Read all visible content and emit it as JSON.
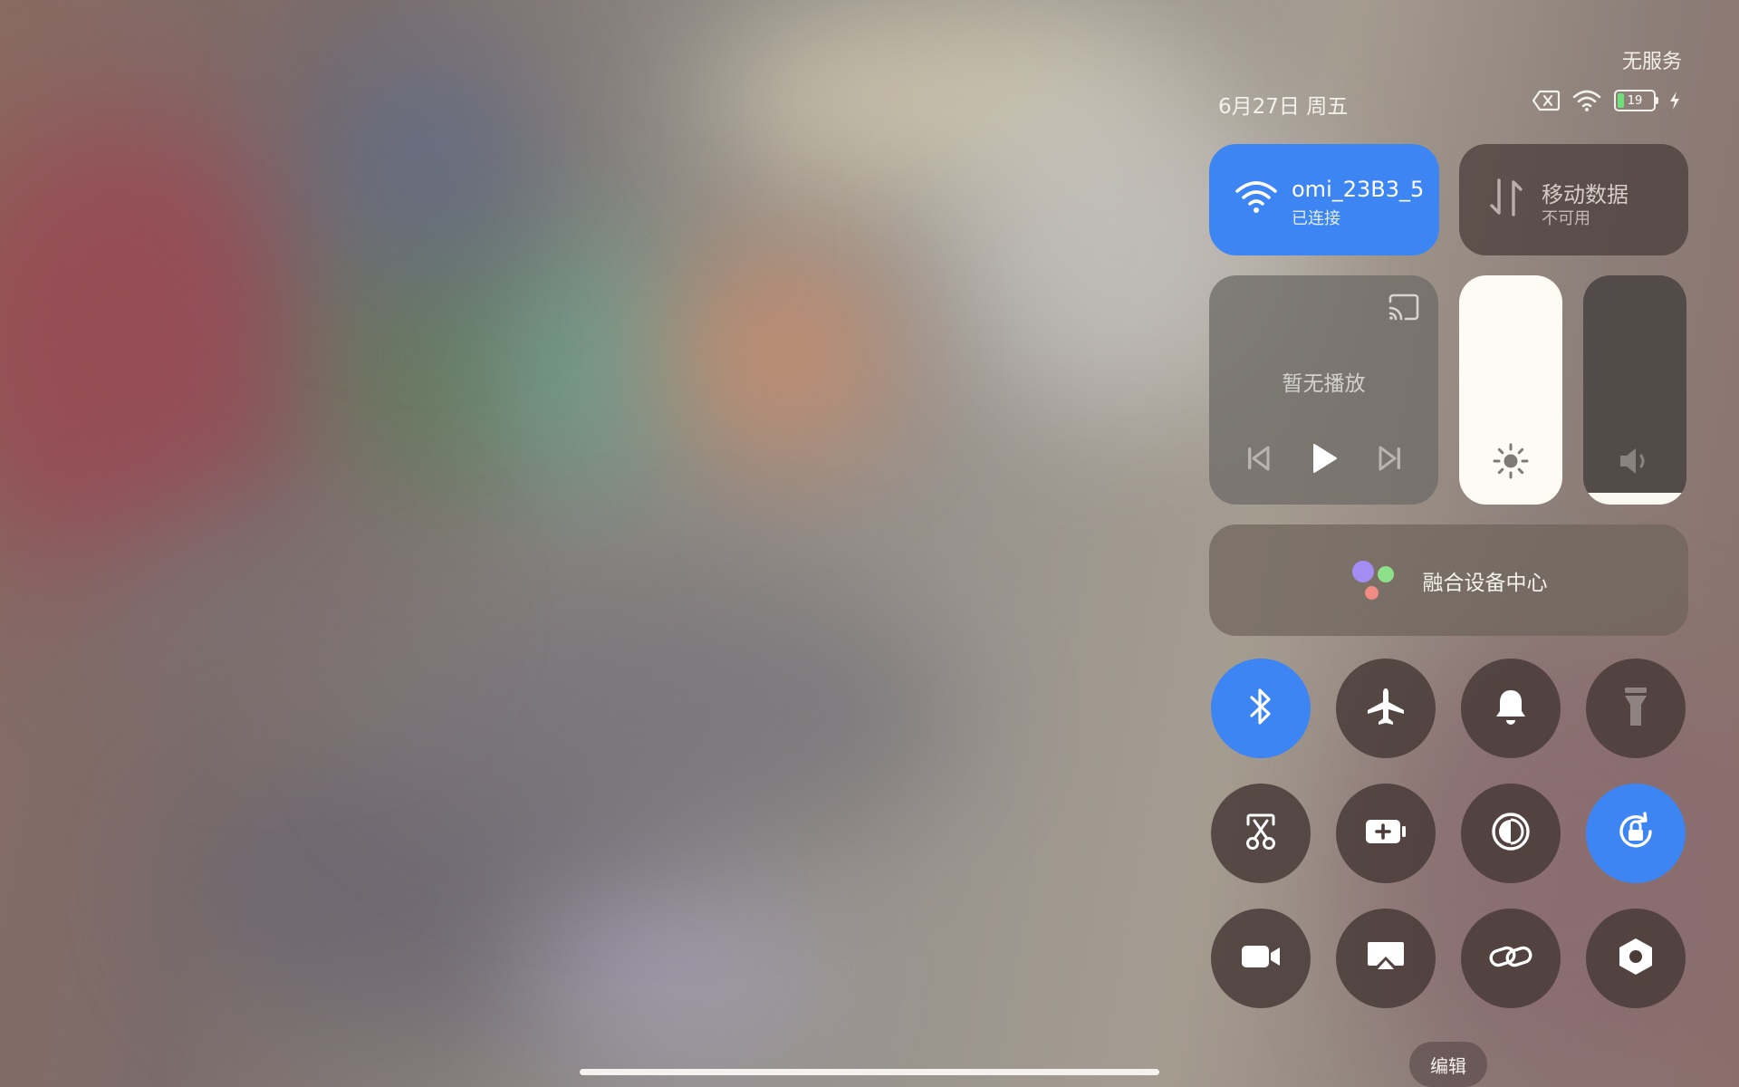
{
  "status": {
    "carrier": "无服务",
    "date": "6月27日 周五",
    "battery_level": "19",
    "icons": [
      "no-sim-icon",
      "wifi-icon",
      "battery-icon",
      "charging-icon"
    ]
  },
  "wifi_tile": {
    "title": "omi_23B3_5",
    "subtitle": "已连接",
    "active": true,
    "accent": "#3c85f2"
  },
  "mobile_tile": {
    "title": "移动数据",
    "subtitle": "不可用",
    "active": false
  },
  "media": {
    "label": "暂无播放",
    "icons": [
      "cast-icon",
      "previous-icon",
      "play-icon",
      "next-icon"
    ]
  },
  "brightness": {
    "level": 1.0
  },
  "volume": {
    "level": 0.05
  },
  "device_center": {
    "label": "融合设备中心"
  },
  "toggles": [
    {
      "name": "bluetooth-icon",
      "active": true
    },
    {
      "name": "airplane-icon",
      "active": false
    },
    {
      "name": "bell-icon",
      "active": false
    },
    {
      "name": "flashlight-icon",
      "active": false
    },
    {
      "name": "screenshot-scissors-icon",
      "active": false
    },
    {
      "name": "battery-saver-icon",
      "active": false
    },
    {
      "name": "contrast-icon",
      "active": false
    },
    {
      "name": "rotation-lock-icon",
      "active": true
    },
    {
      "name": "video-camera-icon",
      "active": false
    },
    {
      "name": "screen-cast-icon",
      "active": false
    },
    {
      "name": "link-icon",
      "active": false
    },
    {
      "name": "settings-hexagon-icon",
      "active": false
    }
  ],
  "edit_label": "编辑"
}
